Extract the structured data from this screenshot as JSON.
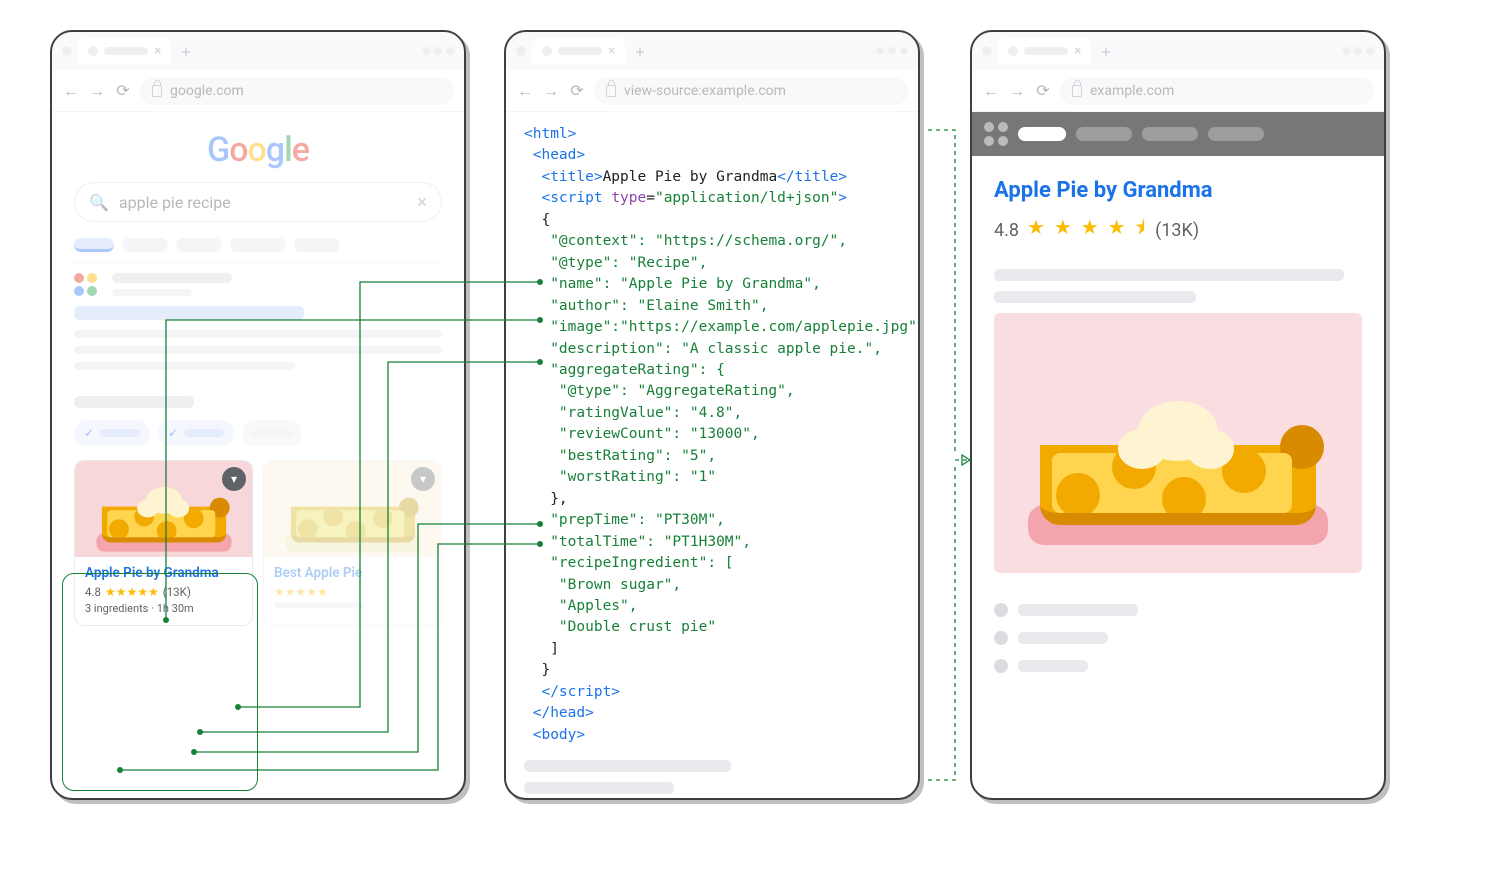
{
  "left": {
    "url": "google.com",
    "logo": "Google",
    "search_query": "apple pie recipe",
    "card1": {
      "title": "Apple Pie by Grandma",
      "rating_value": "4.8",
      "stars": "★★★★★",
      "review_count": "(13K)",
      "meta": "3 ingredients · 1h 30m"
    },
    "card2": {
      "title": "Best Apple Pie"
    }
  },
  "mid": {
    "url": "view-source:example.com",
    "code": {
      "tag_html": "<html>",
      "tag_head_open": "<head>",
      "tag_title_open": "<title>",
      "title_text": "Apple Pie by Grandma",
      "tag_title_close": "</title>",
      "tag_script_open": "<script ",
      "attr_type": "type",
      "attr_eq": "=",
      "attr_val": "\"application/ld+json\"",
      "tag_script_open_end": ">",
      "brace_open": "{",
      "ctx": "\"@context\": \"https://schema.org/\",",
      "type": "\"@type\": \"Recipe\",",
      "name": "\"name\": \"Apple Pie by Grandma\",",
      "author": "\"author\": \"Elaine Smith\",",
      "image": "\"image\":\"https://example.com/applepie.jpg\",",
      "desc": "\"description\": \"A classic apple pie.\",",
      "agg_open": "\"aggregateRating\": {",
      "agg_type": "\"@type\": \"AggregateRating\",",
      "agg_rv": "\"ratingValue\": \"4.8\",",
      "agg_rc": "\"reviewCount\": \"13000\",",
      "agg_best": "\"bestRating\": \"5\",",
      "agg_worst": "\"worstRating\": \"1\"",
      "agg_close": "},",
      "prep": "\"prepTime\": \"PT30M\",",
      "total": "\"totalTime\": \"PT1H30M\",",
      "ing_open": "\"recipeIngredient\": [",
      "ing1": "\"Brown sugar\",",
      "ing2": "\"Apples\",",
      "ing3": "\"Double crust pie\"",
      "ing_close": "]",
      "brace_close": "}",
      "tag_script_close": "</script>",
      "tag_head_close": "</head>",
      "tag_body": "<body>"
    }
  },
  "right": {
    "url": "example.com",
    "title": "Apple Pie by Grandma",
    "rating_value": "4.8",
    "stars": "★ ★ ★ ★ ⯨",
    "review_count": "(13K)"
  }
}
